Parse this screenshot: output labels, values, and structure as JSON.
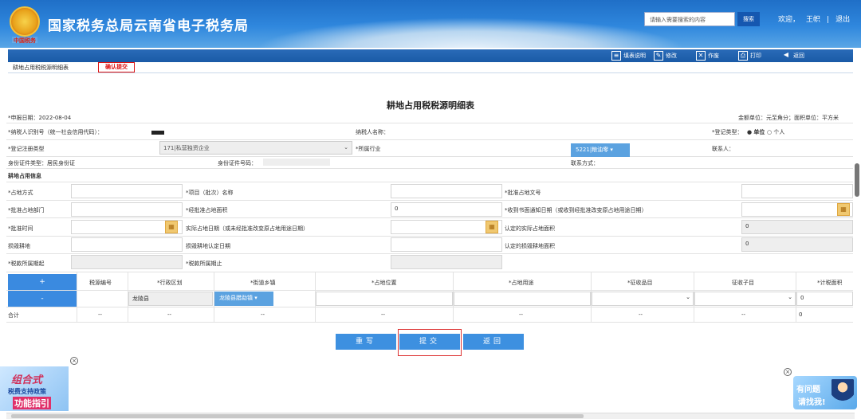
{
  "header": {
    "emblem_caption": "中国税务",
    "title": "国家税务总局云南省电子税务局",
    "search_placeholder": "请输入需要搜索的内容",
    "search_btn": "搜索",
    "welcome": "欢迎，",
    "user": "王帜",
    "sep": "|",
    "logout": "退出"
  },
  "toolbar": {
    "fill_desc": "填表说明",
    "edit": "修改",
    "void": "作废",
    "print": "打印",
    "back": "返回"
  },
  "tabs": {
    "tab1": "耕地占用税税源明细表",
    "tab2": "确认提交"
  },
  "form": {
    "title": "耕地占用税税源明细表",
    "report_date": "*申报日期：2022-08-04",
    "units": "金额单位：元至角分；面积单位：平方米",
    "taxpayer_id_label": "*纳税人识别号（统一社会信用代码）：",
    "taxpayer_name_label": "纳税人名称：",
    "reg_type_label": "*登记类型：",
    "reg_type_opt1": "单位",
    "reg_type_opt2": "个人",
    "reg_reg_type_label": "*登记注册类型",
    "reg_reg_type_value": "171|私营独资企业",
    "industry_label": "*所属行业",
    "industry_value": "5221|粮油零 ▾",
    "contact_label": "联系人：",
    "id_type_label": "身份证件类型：居民身份证",
    "id_no_label": "身份证件号码：",
    "phone_label": "联系方式：",
    "section": "耕地占用信息",
    "occupy_way": "*占地方式",
    "project_name": "*项目（批次）名称",
    "approve_doc": "*批准占地文号",
    "approve_dept": "*批准占地部门",
    "approved_area": "*经批准占地面积",
    "approved_area_value": "0",
    "notice_date": "*收到书面通知日期（或收到经批准改变原占地用途日期）",
    "approve_time": "*批准时间",
    "actual_date": "实际占地日期（或未经批准改变原占地用途日期）",
    "actual_area": "认定的实际占地面积",
    "actual_area_value": "0",
    "damage_land": "损毁耕地",
    "damage_date": "损毁耕地认定日期",
    "damage_area": "认定的损毁耕地面积",
    "damage_area_value": "0",
    "period_start": "*税款所属期起",
    "period_end": "*税款所属期止"
  },
  "grid": {
    "add": "+",
    "remove": "-",
    "headers": [
      "税源编号",
      "*行政区划",
      "*街道乡镇",
      "*占地位置",
      "*占地用途",
      "*征收品目",
      "征收子目",
      "*计税面积"
    ],
    "row": {
      "district": "龙陵县",
      "town": "龙陵县腊勐镇 ▾",
      "area": "0"
    },
    "total": {
      "label": "合计",
      "dash": "--",
      "area": "0"
    }
  },
  "buttons": {
    "reset": "重写",
    "submit": "提交",
    "back": "返回"
  },
  "ads": {
    "left_1": "组合式",
    "left_2": "税费支持政策",
    "left_3": "功能指引",
    "right_1": "有问题",
    "right_2": "请找我!",
    "close": "×"
  }
}
